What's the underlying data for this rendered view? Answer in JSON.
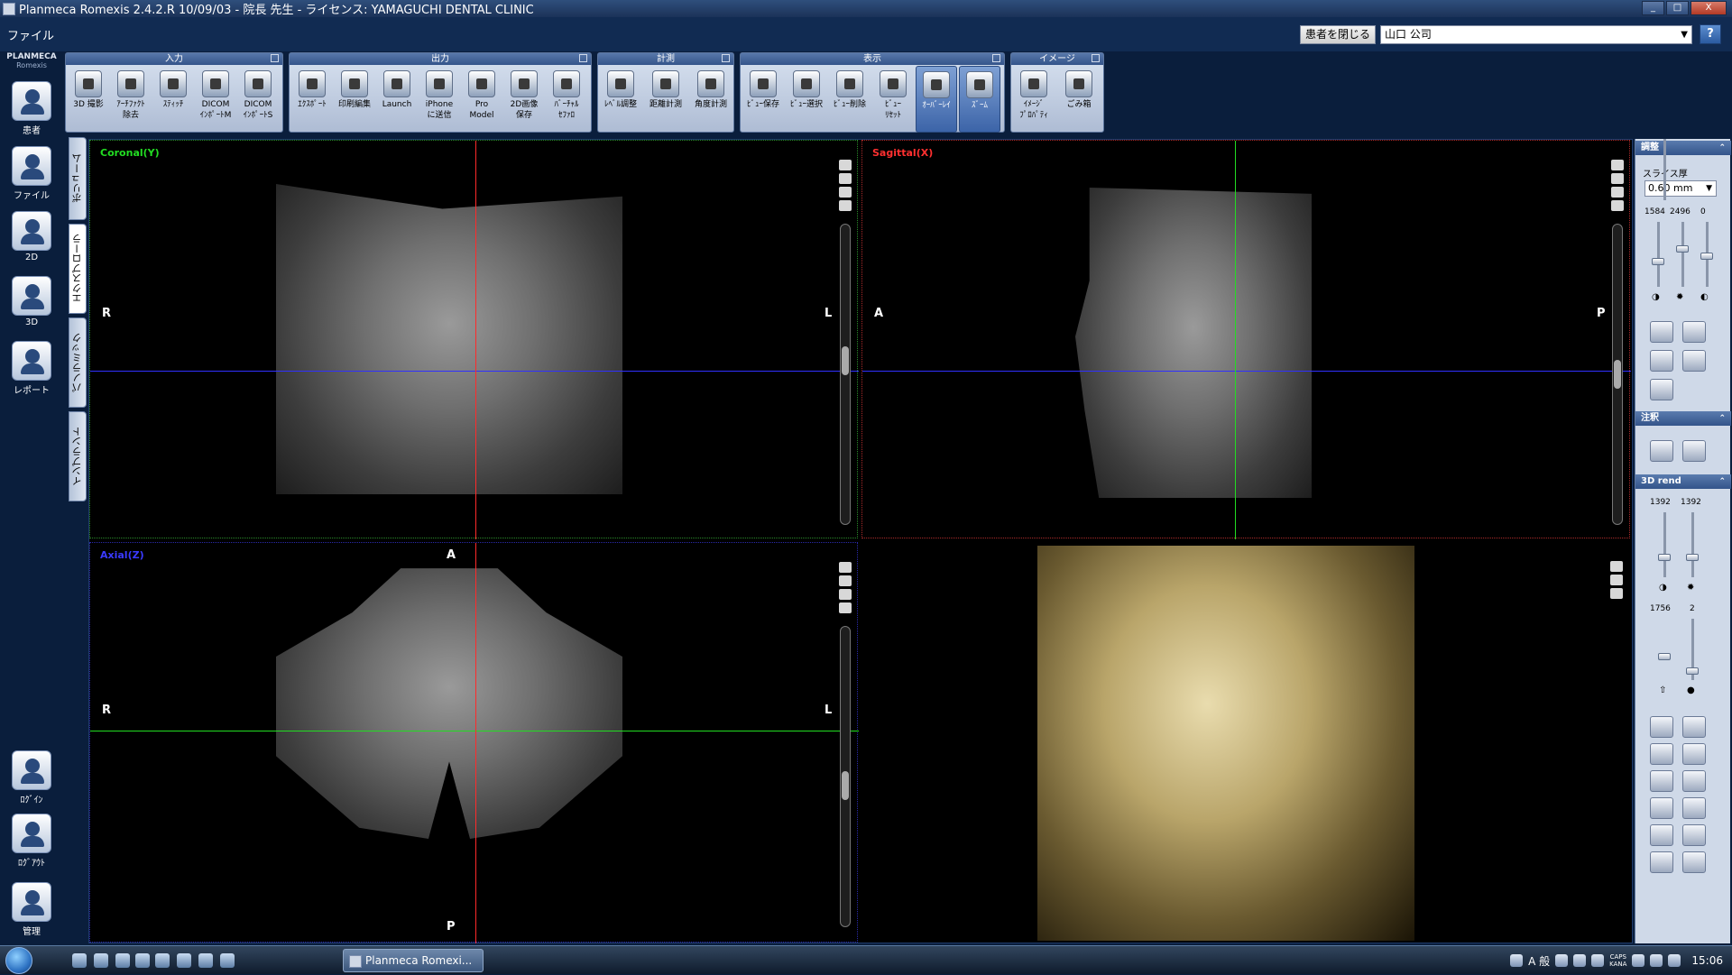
{
  "window": {
    "title": "Planmeca Romexis 2.4.2.R  10/09/03 - 院長 先生 - ライセンス: YAMAGUCHI DENTAL CLINIC",
    "controls": [
      "_",
      "□",
      "X"
    ]
  },
  "menu": {
    "items": [
      "ファイル"
    ]
  },
  "header": {
    "close_patient_label": "患者を閉じる",
    "patient_value": "山口 公司",
    "help_label": "?"
  },
  "logo": {
    "brand": "PLANMECA",
    "product": "Romexis"
  },
  "leftnav": {
    "items": [
      {
        "label": "患者",
        "icon": "patients-icon"
      },
      {
        "label": "ファイル",
        "icon": "file-icon"
      },
      {
        "label": "2D",
        "icon": "2d-icon"
      },
      {
        "label": "3D",
        "icon": "3d-icon"
      },
      {
        "label": "レポート",
        "icon": "report-icon"
      }
    ],
    "bottom_items": [
      {
        "label": "ﾛｸﾞｲﾝ",
        "icon": "login-icon"
      },
      {
        "label": "ﾛｸﾞｱｳﾄ",
        "icon": "logout-icon"
      },
      {
        "label": "管理",
        "icon": "admin-icon"
      }
    ]
  },
  "vertical_tabs": [
    "ボリューム",
    "エクスプローラ",
    "パノラミック",
    "インプラント"
  ],
  "ribbon": {
    "groups": [
      {
        "title": "入力",
        "tools": [
          "3D 撮影",
          "ｱｰﾁﾌｧｸﾄ\n除去",
          "ｽﾃｨｯﾁ",
          "DICOM\nｲﾝﾎﾟｰﾄM",
          "DICOM\nｲﾝﾎﾟｰﾄS"
        ]
      },
      {
        "title": "出力",
        "tools": [
          "ｴｸｽﾎﾟｰﾄ",
          "印刷編集",
          "Launch",
          "iPhone\nに送信",
          "Pro\nModel",
          "2D画像\n保存",
          "ﾊﾞｰﾁｬﾙ\nｾﾌｧﾛ"
        ]
      },
      {
        "title": "計測",
        "tools": [
          "ﾚﾍﾞﾙ調整",
          "距離計測",
          "角度計測"
        ]
      },
      {
        "title": "表示",
        "tools": [
          "ﾋﾞｭｰ保存",
          "ﾋﾞｭｰ選択",
          "ﾋﾞｭｰ削除",
          "ﾋﾞｭｰ\nﾘｾｯﾄ",
          "ｵｰﾊﾞｰﾚｲ",
          "ｽﾞｰﾑ"
        ]
      },
      {
        "title": "イメージ",
        "tools": [
          "ｲﾒｰｼﾞ\nﾌﾟﾛﾊﾟﾃｨ",
          "ごみ箱"
        ]
      }
    ]
  },
  "viewports": {
    "coronal": {
      "title": "Coronal(Y)",
      "left": "R",
      "right": "L",
      "color": "#22dd22"
    },
    "sagittal": {
      "title": "Sagittal(X)",
      "left": "A",
      "right": "P",
      "color": "#ff3030"
    },
    "axial": {
      "title": "Axial(Z)",
      "left": "R",
      "right": "L",
      "top": "A",
      "bottom": "P",
      "color": "#3a3aff"
    }
  },
  "rightpanel": {
    "adjust": {
      "title": "調整",
      "slice_label": "スライス厚",
      "slice_value": "0.60 mm",
      "v1": "1584",
      "v2": "2496",
      "v3": "0"
    },
    "annotation": {
      "title": "注釈"
    },
    "render": {
      "title": "3D rend",
      "a1": "1392",
      "a2": "1392",
      "b1": "1756",
      "b2": "2"
    }
  },
  "taskbar": {
    "item": "Planmeca Romexi...",
    "ime": "A 般",
    "caps": "CAPS",
    "kana": "KANA",
    "clock": "15:06"
  }
}
